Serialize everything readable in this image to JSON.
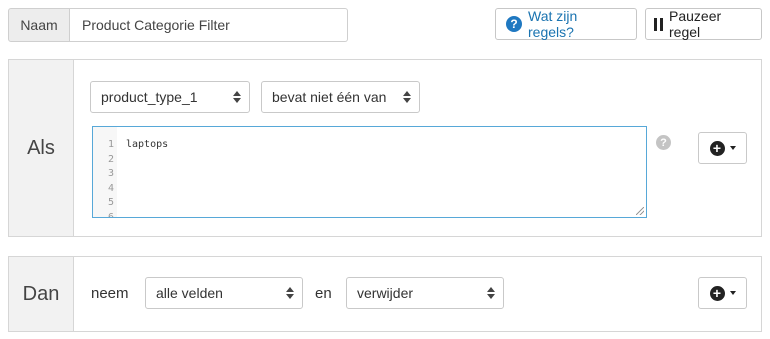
{
  "name_row": {
    "label": "Naam",
    "value": "Product Categorie Filter"
  },
  "toolbar": {
    "rules_label": "Wat zijn regels?",
    "pause_label": "Pauzeer regel"
  },
  "condition": {
    "label": "Als",
    "field_select": "product_type_1",
    "operator_select": "bevat niet één van",
    "editor": {
      "line_numbers": [
        "1",
        "2",
        "3",
        "4",
        "5",
        "6"
      ],
      "code": "laptops"
    },
    "help_symbol": "?"
  },
  "action": {
    "label": "Dan",
    "word_take": "neem",
    "fields_select": "alle velden",
    "word_and": "en",
    "action_select": "verwijder"
  },
  "icons": {
    "plus_symbol": "+"
  },
  "colors": {
    "accent": "#1f78c1",
    "editor_border": "#57a8d8"
  }
}
